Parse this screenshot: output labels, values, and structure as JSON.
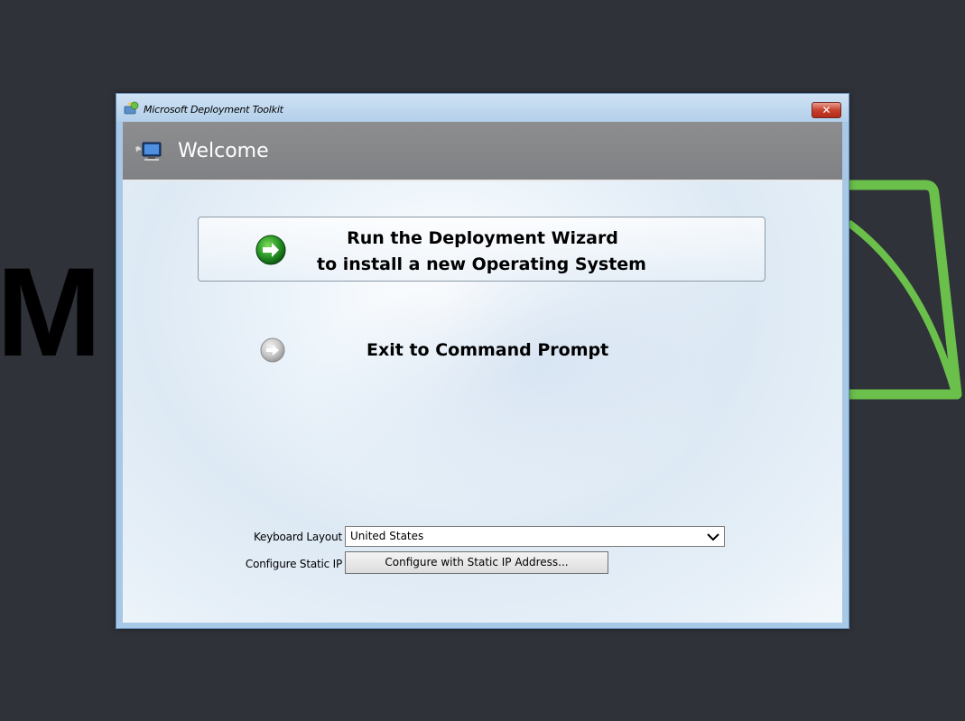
{
  "background": {
    "letter": "M",
    "brand_green": "#6ac04a"
  },
  "window": {
    "title": "Microsoft Deployment Toolkit",
    "close_label": "✕"
  },
  "header": {
    "title": "Welcome"
  },
  "actions": {
    "wizard_line1": "Run the Deployment Wizard",
    "wizard_line2": "to install a new Operating System",
    "exit_label": "Exit to Command Prompt"
  },
  "form": {
    "keyboard_label": "Keyboard Layout",
    "keyboard_value": "United States",
    "static_ip_label": "Configure Static IP",
    "static_ip_button": "Configure with Static IP Address..."
  },
  "icons": {
    "wizard": "green-arrow-icon",
    "exit": "gray-arrow-icon",
    "header": "computer-icon",
    "app": "deployment-toolkit-icon"
  }
}
